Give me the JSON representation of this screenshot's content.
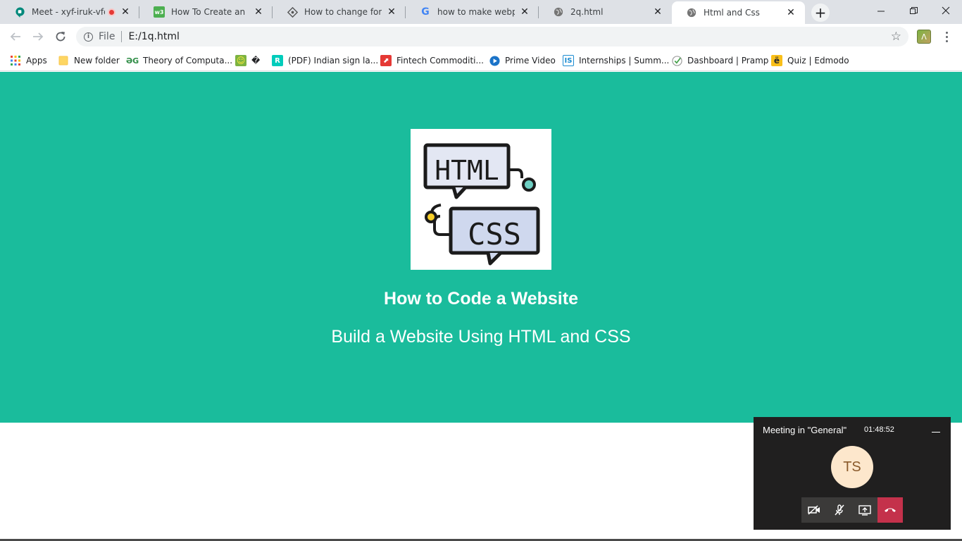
{
  "tabs": [
    {
      "title": "Meet - xyf-iruk-vfe",
      "favicon": "google-meet-icon",
      "recording": true
    },
    {
      "title": "How To Create an Exam",
      "favicon": "w3schools-icon"
    },
    {
      "title": "How to change font siz",
      "favicon": "codegrepper-icon"
    },
    {
      "title": "how to make webpage",
      "favicon": "google-icon"
    },
    {
      "title": "2q.html",
      "favicon": "globe-icon"
    },
    {
      "title": "Html and Css",
      "favicon": "globe-icon",
      "active": true
    }
  ],
  "address_bar": {
    "scheme": "File",
    "url": "E:/1q.html"
  },
  "bookmarks": [
    {
      "label": "Apps",
      "icon": "apps-grid-icon"
    },
    {
      "label": "New folder",
      "icon": "folder-icon"
    },
    {
      "label": "Theory of Computa...",
      "icon": "geeksforgeeks-icon"
    },
    {
      "label": "�",
      "icon": "smiley-icon"
    },
    {
      "label": "(PDF) Indian sign la...",
      "icon": "researchgate-icon"
    },
    {
      "label": "Fintech Commoditi...",
      "icon": "bookmark-red-icon"
    },
    {
      "label": "Prime Video",
      "icon": "prime-video-icon"
    },
    {
      "label": "Internships | Summ...",
      "icon": "internshala-icon"
    },
    {
      "label": "Dashboard | Pramp",
      "icon": "pramp-icon"
    },
    {
      "label": "Quiz | Edmodo",
      "icon": "edmodo-icon"
    }
  ],
  "hero": {
    "logo_line1": "HTML",
    "logo_line2": "CSS",
    "title": "How to Code a Website",
    "subtitle": "Build a Website Using HTML and CSS",
    "background": "#1abc9c"
  },
  "meeting": {
    "title": "Meeting in \"General\"",
    "timer": "01:48:52",
    "avatar_initials": "TS"
  }
}
